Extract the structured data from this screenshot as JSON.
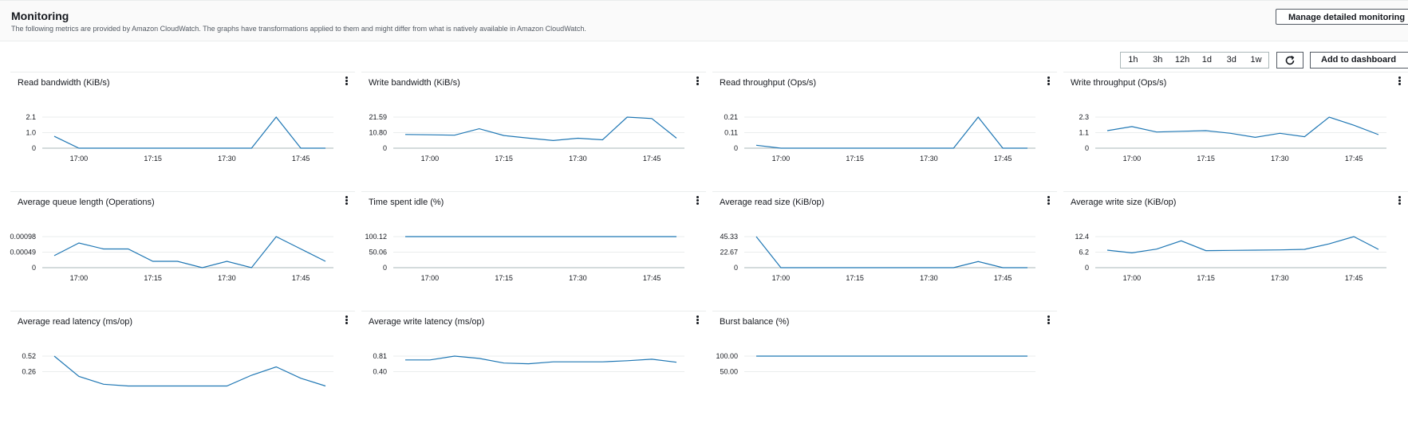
{
  "header": {
    "title": "Monitoring",
    "description": "The following metrics are provided by Amazon CloudWatch. The graphs have transformations applied to them and might differ from what is natively available in Amazon CloudWatch.",
    "manage_button": "Manage detailed monitoring"
  },
  "toolbar": {
    "ranges": [
      "1h",
      "3h",
      "12h",
      "1d",
      "3d",
      "1w"
    ],
    "refresh_icon": "refresh-icon",
    "add_button": "Add to dashboard"
  },
  "colors": {
    "line": "#1f77b4",
    "axis": "#aab7b8"
  },
  "chart_data": [
    {
      "type": "line",
      "title": "Read bandwidth (KiB/s)",
      "yticks": [
        "2.1",
        "1.0",
        "0"
      ],
      "ylim": [
        0,
        2.1
      ],
      "xticks": [
        "17:00",
        "17:15",
        "17:30",
        "17:45"
      ],
      "x": [
        "16:55",
        "17:00",
        "17:05",
        "17:10",
        "17:15",
        "17:20",
        "17:25",
        "17:30",
        "17:35",
        "17:40",
        "17:45",
        "17:50"
      ],
      "values": [
        0.8,
        0,
        0,
        0,
        0,
        0,
        0,
        0,
        0,
        2.1,
        0,
        0
      ]
    },
    {
      "type": "line",
      "title": "Write bandwidth (KiB/s)",
      "yticks": [
        "21.59",
        "10.80",
        "0"
      ],
      "ylim": [
        0,
        21.59
      ],
      "xticks": [
        "17:00",
        "17:15",
        "17:30",
        "17:45"
      ],
      "x": [
        "16:55",
        "17:00",
        "17:05",
        "17:10",
        "17:15",
        "17:20",
        "17:25",
        "17:30",
        "17:35",
        "17:40",
        "17:45",
        "17:50"
      ],
      "values": [
        9.5,
        9.3,
        9.0,
        13.5,
        8.8,
        7.0,
        5.3,
        6.9,
        5.8,
        21.59,
        20.6,
        7.0
      ]
    },
    {
      "type": "line",
      "title": "Read throughput (Ops/s)",
      "yticks": [
        "0.21",
        "0.11",
        "0"
      ],
      "ylim": [
        0,
        0.21
      ],
      "xticks": [
        "17:00",
        "17:15",
        "17:30",
        "17:45"
      ],
      "x": [
        "16:55",
        "17:00",
        "17:05",
        "17:10",
        "17:15",
        "17:20",
        "17:25",
        "17:30",
        "17:35",
        "17:40",
        "17:45",
        "17:50"
      ],
      "values": [
        0.02,
        0,
        0,
        0,
        0,
        0,
        0,
        0,
        0,
        0.21,
        0,
        0
      ]
    },
    {
      "type": "line",
      "title": "Write throughput (Ops/s)",
      "yticks": [
        "2.3",
        "1.1",
        "0"
      ],
      "ylim": [
        0,
        2.3
      ],
      "xticks": [
        "17:00",
        "17:15",
        "17:30",
        "17:45"
      ],
      "x": [
        "16:55",
        "17:00",
        "17:05",
        "17:10",
        "17:15",
        "17:20",
        "17:25",
        "17:30",
        "17:35",
        "17:40",
        "17:45",
        "17:50"
      ],
      "values": [
        1.3,
        1.6,
        1.2,
        1.25,
        1.3,
        1.1,
        0.8,
        1.1,
        0.85,
        2.3,
        1.7,
        1.0
      ]
    },
    {
      "type": "line",
      "title": "Average queue length (Operations)",
      "yticks": [
        "0.00098",
        "0.00049",
        "0"
      ],
      "ylim": [
        0,
        0.00098
      ],
      "xticks": [
        "17:00",
        "17:15",
        "17:30",
        "17:45"
      ],
      "x": [
        "16:55",
        "17:00",
        "17:05",
        "17:10",
        "17:15",
        "17:20",
        "17:25",
        "17:30",
        "17:35",
        "17:40",
        "17:45",
        "17:50"
      ],
      "values": [
        0.00038,
        0.00078,
        0.00059,
        0.00059,
        0.0002,
        0.0002,
        0,
        0.0002,
        0,
        0.00098,
        0.00059,
        0.0002
      ]
    },
    {
      "type": "line",
      "title": "Time spent idle (%)",
      "yticks": [
        "100.12",
        "50.06",
        "0"
      ],
      "ylim": [
        0,
        100.12
      ],
      "xticks": [
        "17:00",
        "17:15",
        "17:30",
        "17:45"
      ],
      "x": [
        "16:55",
        "17:00",
        "17:05",
        "17:10",
        "17:15",
        "17:20",
        "17:25",
        "17:30",
        "17:35",
        "17:40",
        "17:45",
        "17:50"
      ],
      "values": [
        100,
        100,
        100,
        100,
        100,
        100,
        100,
        100,
        100,
        100,
        100,
        100
      ]
    },
    {
      "type": "line",
      "title": "Average read size (KiB/op)",
      "yticks": [
        "45.33",
        "22.67",
        "0"
      ],
      "ylim": [
        0,
        45.33
      ],
      "xticks": [
        "17:00",
        "17:15",
        "17:30",
        "17:45"
      ],
      "x": [
        "16:55",
        "17:00",
        "17:05",
        "17:10",
        "17:15",
        "17:20",
        "17:25",
        "17:30",
        "17:35",
        "17:40",
        "17:45",
        "17:50"
      ],
      "values": [
        45.33,
        0,
        0,
        0,
        0,
        0,
        0,
        0,
        0,
        9.0,
        0,
        0
      ]
    },
    {
      "type": "line",
      "title": "Average write size (KiB/op)",
      "yticks": [
        "12.4",
        "6.2",
        "0"
      ],
      "ylim": [
        0,
        12.4
      ],
      "xticks": [
        "17:00",
        "17:15",
        "17:30",
        "17:45"
      ],
      "x": [
        "16:55",
        "17:00",
        "17:05",
        "17:10",
        "17:15",
        "17:20",
        "17:25",
        "17:30",
        "17:35",
        "17:40",
        "17:45",
        "17:50"
      ],
      "values": [
        7.0,
        5.9,
        7.4,
        10.7,
        6.8,
        6.9,
        7.0,
        7.1,
        7.3,
        9.5,
        12.4,
        7.3
      ]
    },
    {
      "type": "line",
      "title": "Average read latency (ms/op)",
      "yticks": [
        "0.52",
        "0.26"
      ],
      "ylim": [
        0,
        0.52
      ],
      "xticks": [],
      "x": [
        "16:55",
        "17:00",
        "17:05",
        "17:10",
        "17:15",
        "17:20",
        "17:25",
        "17:30",
        "17:35",
        "17:40",
        "17:45",
        "17:50"
      ],
      "values": [
        0.52,
        0.18,
        0.05,
        0.02,
        0.02,
        0.02,
        0.02,
        0.02,
        0.2,
        0.34,
        0.15,
        0.02
      ]
    },
    {
      "type": "line",
      "title": "Average write latency (ms/op)",
      "yticks": [
        "0.81",
        "0.40"
      ],
      "ylim": [
        0,
        0.81
      ],
      "xticks": [],
      "x": [
        "16:55",
        "17:00",
        "17:05",
        "17:10",
        "17:15",
        "17:20",
        "17:25",
        "17:30",
        "17:35",
        "17:40",
        "17:45",
        "17:50"
      ],
      "values": [
        0.71,
        0.71,
        0.81,
        0.75,
        0.63,
        0.61,
        0.66,
        0.66,
        0.66,
        0.69,
        0.73,
        0.65
      ]
    },
    {
      "type": "line",
      "title": "Burst balance (%)",
      "yticks": [
        "100.00",
        "50.00"
      ],
      "ylim": [
        0,
        100
      ],
      "xticks": [],
      "x": [
        "16:55",
        "17:00",
        "17:05",
        "17:10",
        "17:15",
        "17:20",
        "17:25",
        "17:30",
        "17:35",
        "17:40",
        "17:45",
        "17:50"
      ],
      "values": [
        100,
        100,
        100,
        100,
        100,
        100,
        100,
        100,
        100,
        100,
        100,
        100
      ]
    }
  ]
}
